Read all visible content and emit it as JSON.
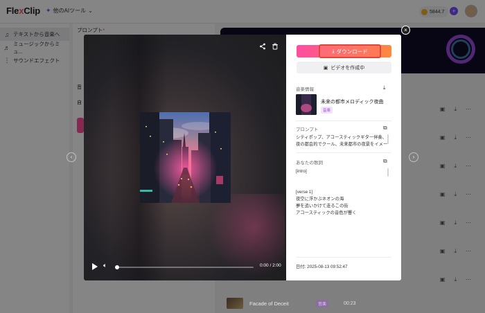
{
  "app": {
    "logo_main": "Fle",
    "logo_x": "x",
    "logo_rest": "Clip",
    "ai_tools": "他のAIツール",
    "credits": "5844.7",
    "plus": "+"
  },
  "sidebar": {
    "items": [
      {
        "label": "テキストから音楽へ",
        "icon": "music-note-icon",
        "glyph": "♫"
      },
      {
        "label": "ミュージックからミュ...",
        "icon": "music-icon",
        "glyph": "♬"
      },
      {
        "label": "サウンドエフェクト",
        "icon": "waveform-icon",
        "glyph": "⋮"
      }
    ]
  },
  "background": {
    "prompt_label": "プロンプト",
    "required": "*",
    "tab1": "音",
    "tab2": "自"
  },
  "list": {
    "last_song": {
      "title": "Facade of Deceit",
      "tag": "音楽",
      "duration": "00:23"
    }
  },
  "modal": {
    "close": "×",
    "download_label": "ダウンロード",
    "make_video_label": "ビデオを作成中",
    "music_info_label": "音楽情報",
    "song_title": "未来の都市メロディック夜曲",
    "song_badge": "音楽",
    "prompt_label": "プロンプト",
    "prompt_lines": [
      "シティポップ、アコースティックギター伴奏、",
      "夜の都会的でクール、未来都市の夜景をイメー"
    ],
    "lyrics_label": "あなたの歌詞",
    "lyrics_lines": [
      "[intro]",
      "",
      "",
      "[verse 1]",
      "夜空に浮かぶネオンの海",
      "夢を追いかけて走るこの街",
      "アコースティックの音色が響く"
    ],
    "date_label": "日付:",
    "date_value": "2025-08-13 09:52:47",
    "time_display": "0:00 / 2:00"
  },
  "colors": {
    "accent": "#7a4dff",
    "download_start": "#ff4da3",
    "download_end": "#ff8a3d",
    "badge": "#a24bd6"
  }
}
